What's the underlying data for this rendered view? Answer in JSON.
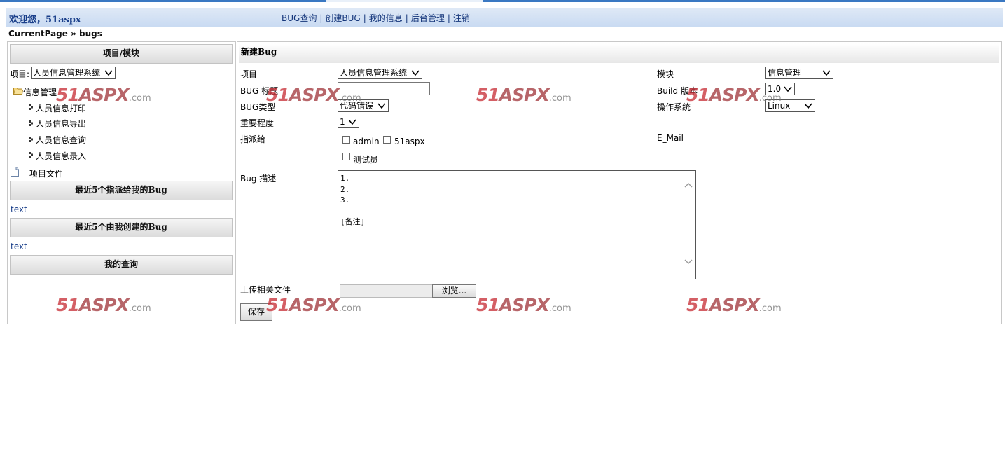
{
  "header": {
    "welcome": "欢迎您，51aspx",
    "nav": [
      "BUG查询",
      "创建BUG",
      "我的信息",
      "后台管理",
      "注销"
    ],
    "nav_separator": "|",
    "breadcrumb": "CurrentPage » bugs"
  },
  "sidebar": {
    "project_module_title": "项目/模块",
    "project_label": "项目:",
    "project_selected": "人员信息管理系统",
    "tree_root": "信息管理",
    "tree_children": [
      "人员信息打印",
      "人员信息导出",
      "人员信息查询",
      "人员信息录入"
    ],
    "project_files": "项目文件",
    "assigned_title": "最近5个指派给我的Bug",
    "assigned_text": "text",
    "created_title": "最近5个由我创建的Bug",
    "created_text": "text",
    "my_query_title": "我的查询"
  },
  "form": {
    "title": "新建Bug",
    "project_label": "项目",
    "project_value": "人员信息管理系统",
    "module_label": "模块",
    "module_value": "信息管理",
    "bug_title_label": "BUG 标题",
    "bug_title_value": "",
    "build_label": "Build 版本",
    "build_value": "1.0",
    "bug_type_label": "BUG类型",
    "bug_type_value": "代码错误",
    "os_label": "操作系统",
    "os_value": "Linux",
    "severity_label": "重要程度",
    "severity_value": "1",
    "assign_label": "指派给",
    "assignees": [
      "admin",
      "51aspx",
      "测试员"
    ],
    "email_label": "E_Mail",
    "description_label": "Bug 描述",
    "description_lines": [
      "1.",
      "2.",
      "3.",
      "",
      "[备注]"
    ],
    "upload_label": "上传相关文件",
    "browse_label": "浏览...",
    "save_label": "保存"
  },
  "watermark": {
    "num": "51",
    "brand": "ASPX",
    "tld": ".com"
  },
  "colors": {
    "header_gradient_top": "#dfe9f6",
    "header_gradient_bottom": "#c8daf2",
    "link_blue": "#1a3f8a",
    "watermark_red": "#c9333a"
  }
}
